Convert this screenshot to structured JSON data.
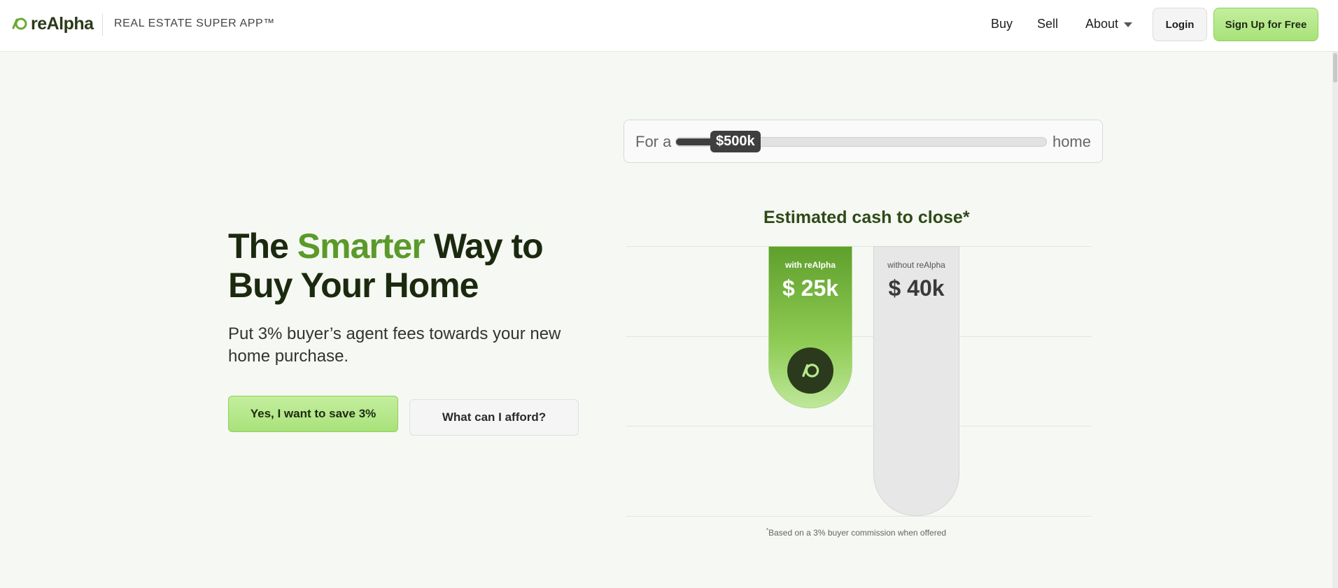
{
  "header": {
    "logo_text": "reAlpha",
    "tagline": "REAL ESTATE SUPER APP™",
    "nav": {
      "buy": "Buy",
      "sell": "Sell",
      "about": "About"
    },
    "login": "Login",
    "signup": "Sign Up for Free"
  },
  "hero": {
    "title_part1": "The ",
    "title_accent": "Smarter",
    "title_part2": " Way to Buy Your Home",
    "subtitle": "Put 3% buyer’s agent fees towards your new home purchase.",
    "cta_primary": "Yes, I want to save 3%",
    "cta_secondary": "What can I afford?"
  },
  "slider": {
    "prefix": "For a",
    "value_label": "$500k",
    "suffix": "home",
    "fill_fraction": 0.12
  },
  "chart_data": {
    "type": "bar",
    "title": "Estimated cash to close*",
    "categories": [
      "with reAlpha",
      "without reAlpha"
    ],
    "values": [
      25,
      40
    ],
    "value_labels": [
      "$ 25k",
      "$ 40k"
    ],
    "colors": [
      "#6aaa34",
      "#e7e7e7"
    ],
    "footnote": "Based on a 3% buyer commission when offered",
    "footnote_mark": "*"
  },
  "icons": [
    "logo-icon",
    "chevron-down-icon",
    "realpha-badge-icon"
  ],
  "colors": {
    "brand_green": "#5a9a2a",
    "cta_green": "#b6e88c",
    "dark": "#1b2a0f"
  }
}
